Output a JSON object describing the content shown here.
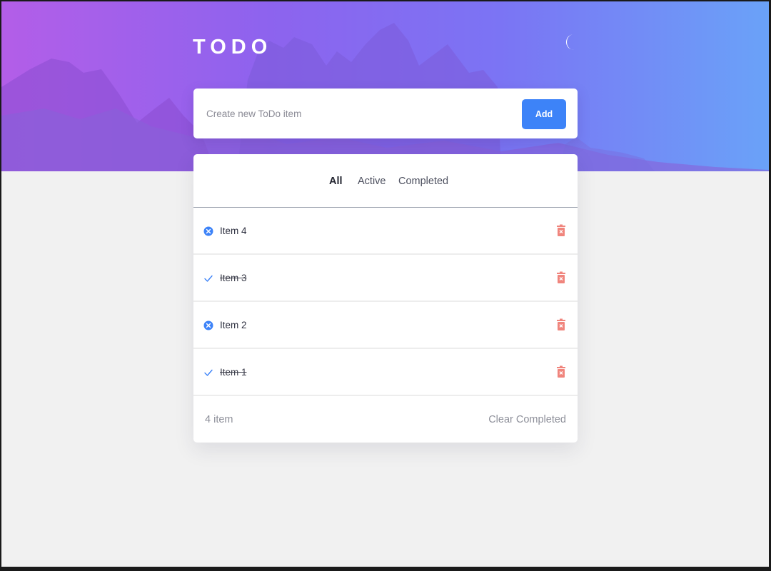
{
  "app": {
    "title": "TODO",
    "theme_icon": "moon-icon"
  },
  "new_todo": {
    "placeholder": "Create new ToDo item",
    "value": "",
    "add_label": "Add"
  },
  "filters": {
    "tabs": [
      "All",
      "Active",
      "Completed"
    ],
    "selected": "All"
  },
  "items": [
    {
      "label": "Item 4",
      "completed": false,
      "status_icon": "x-circle-icon"
    },
    {
      "label": "Item 3",
      "completed": true,
      "status_icon": "checkmark-icon"
    },
    {
      "label": "Item 2",
      "completed": false,
      "status_icon": "x-circle-icon"
    },
    {
      "label": "Item 1",
      "completed": true,
      "status_icon": "checkmark-icon"
    }
  ],
  "footer": {
    "count_text": "4 item",
    "clear_label": "Clear Completed"
  },
  "colors": {
    "accent": "#3d83f8",
    "delete": "#f0857d",
    "hero_start": "#b35ee8",
    "hero_end": "#6aa2f8",
    "page_background": "#f1f1f1"
  }
}
